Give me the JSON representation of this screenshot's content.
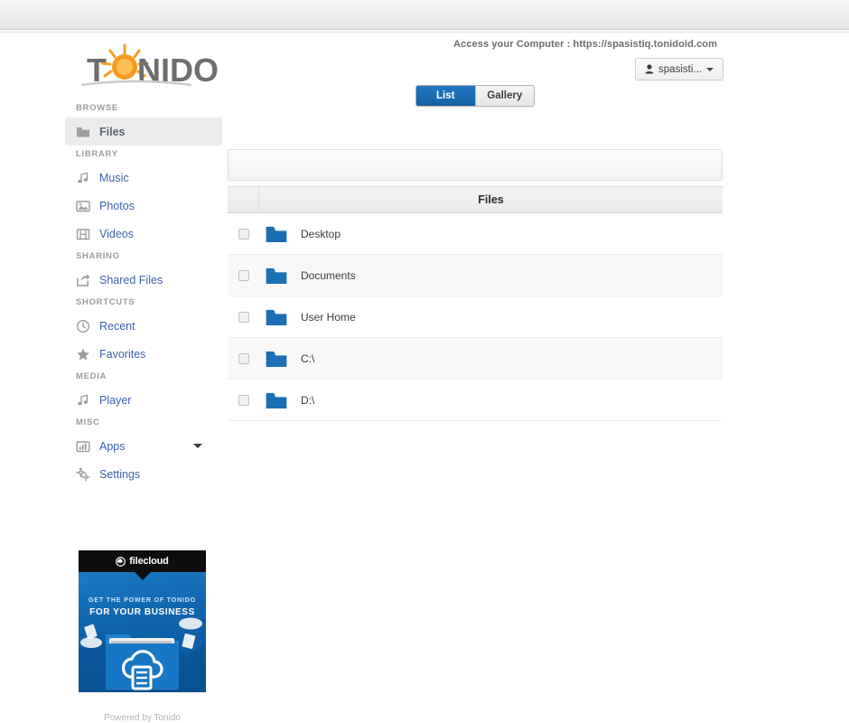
{
  "header": {
    "logo_text": "TONIDO",
    "access_line": "Access your Computer : https://spasistiq.tonidoid.com",
    "user_button_label": "spasisti...",
    "user_icon": "user-icon",
    "caret_icon": "chevron-down-icon"
  },
  "sidebar": {
    "groups": [
      {
        "title": "BROWSE",
        "items": [
          {
            "label": "Files",
            "icon": "folder-icon",
            "active": true
          }
        ]
      },
      {
        "title": "LIBRARY",
        "items": [
          {
            "label": "Music",
            "icon": "music-note-icon",
            "active": false
          },
          {
            "label": "Photos",
            "icon": "image-icon",
            "active": false
          },
          {
            "label": "Videos",
            "icon": "film-icon",
            "active": false
          }
        ]
      },
      {
        "title": "SHARING",
        "items": [
          {
            "label": "Shared Files",
            "icon": "share-icon",
            "active": false
          }
        ]
      },
      {
        "title": "SHORTCUTS",
        "items": [
          {
            "label": "Recent",
            "icon": "clock-icon",
            "active": false
          },
          {
            "label": "Favorites",
            "icon": "star-icon",
            "active": false
          }
        ]
      },
      {
        "title": "MEDIA",
        "items": [
          {
            "label": "Player",
            "icon": "music-note-icon",
            "active": false
          }
        ]
      },
      {
        "title": "MISC",
        "items": [
          {
            "label": "Apps",
            "icon": "chart-bars-icon",
            "active": false,
            "caret": true
          },
          {
            "label": "Settings",
            "icon": "gears-icon",
            "active": false
          }
        ]
      }
    ]
  },
  "promo": {
    "brand": "filecloud",
    "brand_icon": "filecloud-logo-icon",
    "line1": "GET THE POWER OF TONIDO",
    "line2": "FOR YOUR BUSINESS"
  },
  "footer": {
    "powered_by": "Powered by Tonido"
  },
  "main": {
    "tabs": [
      {
        "label": "List",
        "selected": true
      },
      {
        "label": "Gallery",
        "selected": false
      }
    ],
    "toolbar": {
      "contents": ""
    },
    "table": {
      "header_checkbox_col": "",
      "header_name": "Files",
      "rows": [
        {
          "name": "Desktop",
          "icon": "folder-icon",
          "checked": false
        },
        {
          "name": "Documents",
          "icon": "folder-icon",
          "checked": false
        },
        {
          "name": "User Home",
          "icon": "folder-icon",
          "checked": false
        },
        {
          "name": "C:\\",
          "icon": "folder-icon",
          "checked": false
        },
        {
          "name": "D:\\",
          "icon": "folder-icon",
          "checked": false
        }
      ]
    }
  },
  "colors": {
    "link_blue": "#3a62ab",
    "tab_active_blue": "#15619f",
    "folder_blue": "#1a6fb5",
    "sidebar_active_bg": "#ececec",
    "promo_blue": "#0f63ab"
  }
}
